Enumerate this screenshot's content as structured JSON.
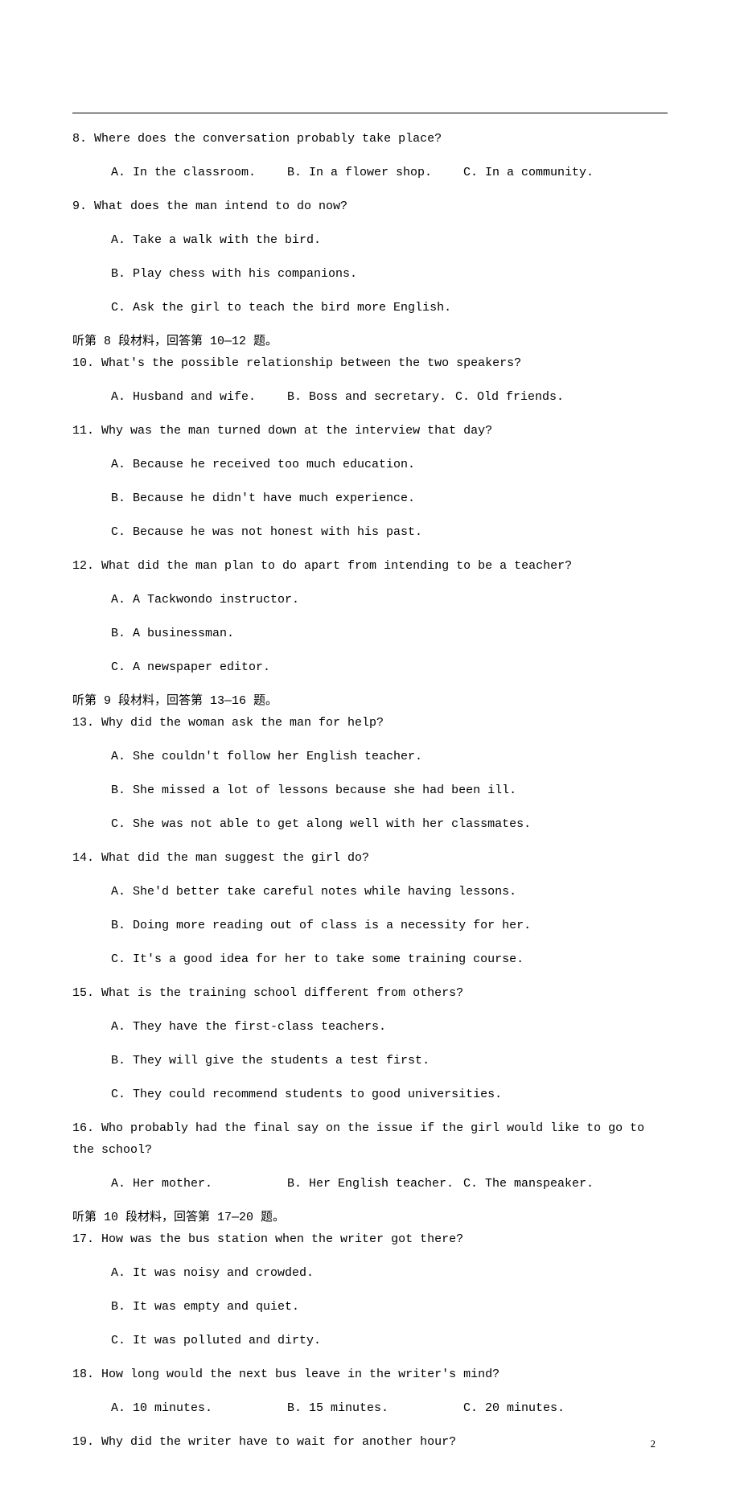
{
  "page_number": "2",
  "q8": {
    "text": "8. Where does the conversation probably take place?",
    "a": "A. In the classroom.",
    "b": "B. In a flower shop.",
    "c": "C. In a community."
  },
  "q9": {
    "text": "9. What does the man intend to do now?",
    "a": "A. Take a walk with the bird.",
    "b": "B. Play chess with his companions.",
    "c": "C. Ask the girl to teach the bird more English."
  },
  "sec8": "听第 8 段材料，回答第 10—12 题。",
  "q10": {
    "text": "10. What's the possible relationship between the two speakers?",
    "a": "A. Husband and wife.",
    "b": "B. Boss and secretary.",
    "c": "C. Old friends."
  },
  "q11": {
    "text": "11. Why was the man turned down at the interview that day?",
    "a": "A. Because he received too much education.",
    "b": "B. Because he didn't have much experience.",
    "c": "C. Because he was not honest with his past."
  },
  "q12": {
    "text": "12. What did the man plan to do apart from intending to be a teacher?",
    "a": "A. A Tackwondo instructor.",
    "b": "B. A businessman.",
    "c": "C. A newspaper editor."
  },
  "sec9": "听第 9 段材料，回答第 13—16 题。",
  "q13": {
    "text": "13. Why did the woman ask the man for help?",
    "a": "A. She couldn't follow her English teacher.",
    "b": "B. She missed a lot of lessons because she had been ill.",
    "c": "C. She was not able to get along well with her classmates."
  },
  "q14": {
    "text": "14. What did the man suggest the girl do?",
    "a": "A. She'd better take careful notes while having lessons.",
    "b": "B. Doing more reading out of class is a necessity for her.",
    "c": "C. It's a good idea for her to take some training course."
  },
  "q15": {
    "text": "15. What is the training school different from others?",
    "a": "A. They have the first-class teachers.",
    "b": "B. They will give the students a test first.",
    "c": "C. They could recommend students to good universities."
  },
  "q16": {
    "text": "16. Who probably had the final say on the issue if the girl would like to go to the school?",
    "a": "A. Her mother.",
    "b": "B. Her English teacher.",
    "c": "C. The manspeaker."
  },
  "sec10": "听第 10 段材料，回答第 17—20 题。",
  "q17": {
    "text": "17. How was the bus station when the writer got there?",
    "a": "A. It was noisy and crowded.",
    "b": "B. It was empty and quiet.",
    "c": "C. It was polluted and dirty."
  },
  "q18": {
    "text": "18. How long would the next bus leave in the writer's mind?",
    "a": "A. 10 minutes.",
    "b": "B. 15 minutes.",
    "c": "C. 20 minutes."
  },
  "q19": {
    "text": "19. Why did the writer have to wait for another hour?"
  }
}
